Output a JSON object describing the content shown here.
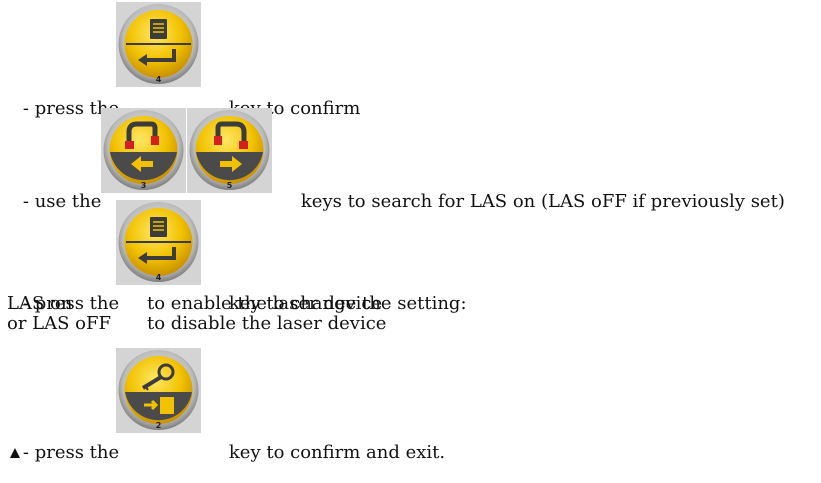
{
  "steps": [
    {
      "prefix": "- press the",
      "suffix": "key to confirm",
      "keys": [
        {
          "number": "4",
          "icon": "confirm-enter-icon"
        }
      ]
    },
    {
      "prefix": "- use the",
      "suffix": "keys to search for LAS on (LAS oFF if previously set)",
      "keys": [
        {
          "number": "3",
          "icon": "laser-left-arrow-icon"
        },
        {
          "number": "5",
          "icon": "laser-right-arrow-icon"
        }
      ]
    },
    {
      "prefix": "- press the",
      "suffix": "key to change the setting:",
      "keys": [
        {
          "number": "4",
          "icon": "confirm-enter-icon"
        }
      ],
      "options": [
        {
          "value": "LAS on",
          "description": "to enable the laser device"
        },
        {
          "value": "or LAS oFF",
          "description": "to disable the laser device"
        }
      ]
    },
    {
      "prefix": "- press the",
      "suffix": "key to confirm and exit.",
      "keys": [
        {
          "number": "2",
          "icon": "settings-exit-icon"
        }
      ]
    }
  ],
  "colors": {
    "key_background": "#d4d4d4",
    "button_yellow": "#f2c200",
    "button_rim": "#9a9a9a",
    "icon_dark": "#3c3c3c",
    "icon_red": "#d42020"
  }
}
